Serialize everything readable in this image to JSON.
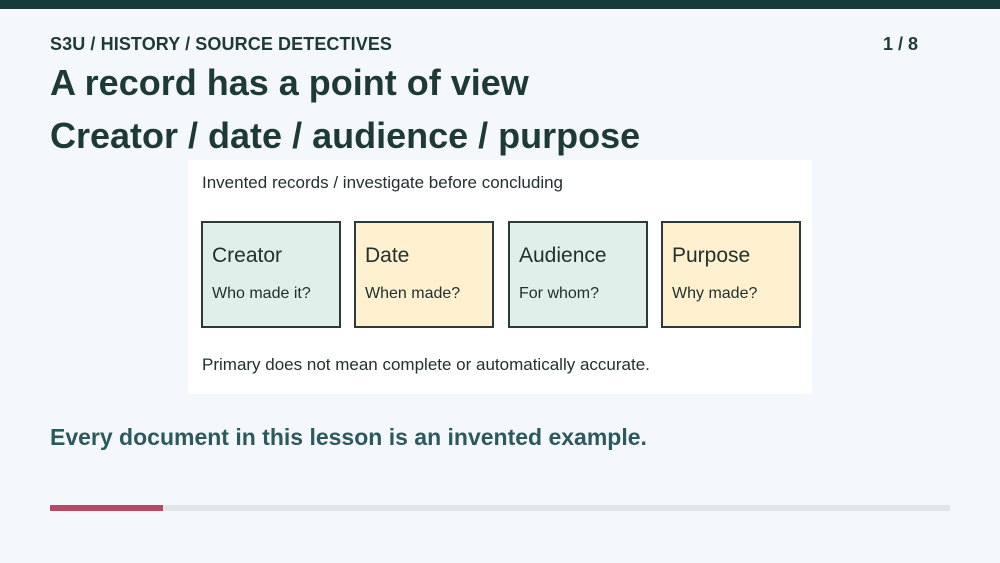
{
  "colors": {
    "top_bar": "#173b3b",
    "background": "#f4f8fc",
    "heading_text": "#1d3a38",
    "footer_text": "#2b5a5e",
    "card_green": "#e0efea",
    "card_cream": "#fff1cf",
    "progress_fill": "#b44a63",
    "progress_track": "#e1e4e8"
  },
  "header": {
    "breadcrumb": "S3U / HISTORY / SOURCE DETECTIVES",
    "page_counter": "1 / 8"
  },
  "slide": {
    "title": "A record has a point of view",
    "subtitle": "Creator / date / audience / purpose"
  },
  "panel": {
    "caption": "Invented records / investigate before concluding",
    "cards": [
      {
        "title": "Creator",
        "question": "Who made it?",
        "color": "green"
      },
      {
        "title": "Date",
        "question": "When made?",
        "color": "cream"
      },
      {
        "title": "Audience",
        "question": "For whom?",
        "color": "green"
      },
      {
        "title": "Purpose",
        "question": "Why made?",
        "color": "cream"
      }
    ],
    "note": "Primary does not mean complete or automatically accurate."
  },
  "footer": {
    "note": "Every document in this lesson is an invented example."
  },
  "progress": {
    "current": 1,
    "total": 8,
    "fraction": 0.125
  }
}
